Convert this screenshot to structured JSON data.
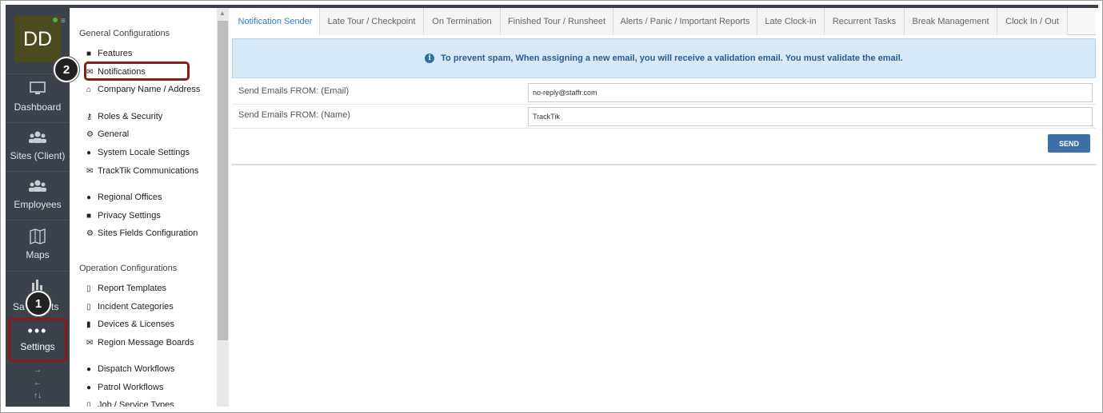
{
  "rail": {
    "avatar": "DD",
    "items": [
      {
        "label": "Dashboard",
        "icon": "monitor-icon"
      },
      {
        "label": "Sites (Client)",
        "icon": "users-icon"
      },
      {
        "label": "Employees",
        "icon": "users-icon"
      },
      {
        "label": "Maps",
        "icon": "map-icon"
      },
      {
        "label": "Sa",
        "icon": "bar-chart-icon"
      }
    ],
    "reports_suffix": "ts",
    "settings": {
      "label": "Settings",
      "dots": "•••"
    },
    "arrows": [
      "→",
      "←",
      "↑↓"
    ]
  },
  "callouts": {
    "one": "1",
    "two": "2"
  },
  "menu": {
    "general_header": "General Configurations",
    "general_items": [
      {
        "label": "Features",
        "icon": "briefcase-icon"
      },
      {
        "label": "Notifications",
        "icon": "envelope-icon"
      },
      {
        "label": "Company Name / Address",
        "icon": "home-icon"
      },
      {
        "label": "Roles & Security",
        "icon": "key-icon"
      },
      {
        "label": "General",
        "icon": "gear-icon"
      },
      {
        "label": "System Locale Settings",
        "icon": "globe-icon"
      },
      {
        "label": "TrackTik Communications",
        "icon": "envelope-icon"
      },
      {
        "label": "Regional Offices",
        "icon": "globe-icon"
      },
      {
        "label": "Privacy Settings",
        "icon": "lock-icon"
      },
      {
        "label": "Sites Fields Configuration",
        "icon": "gear-icon"
      }
    ],
    "operation_header": "Operation Configurations",
    "operation_items": [
      {
        "label": "Report Templates",
        "icon": "file-icon"
      },
      {
        "label": "Incident Categories",
        "icon": "file-icon"
      },
      {
        "label": "Devices & Licenses",
        "icon": "tablet-icon"
      },
      {
        "label": "Region Message Boards",
        "icon": "envelope-icon"
      },
      {
        "label": "Dispatch Workflows",
        "icon": "globe-icon"
      },
      {
        "label": "Patrol Workflows",
        "icon": "globe-icon"
      },
      {
        "label": "Job / Service Types",
        "icon": "file-icon"
      }
    ]
  },
  "tabs": [
    "Notification Sender",
    "Late Tour / Checkpoint",
    "On Termination",
    "Finished Tour / Runsheet",
    "Alerts / Panic / Important Reports",
    "Late Clock-in",
    "Recurrent Tasks",
    "Break Management",
    "Clock In / Out"
  ],
  "active_tab": "Notification Sender",
  "alert": {
    "icon": "i",
    "text": "To prevent spam, When assigning a new email, you will receive a validation email. You must validate the email."
  },
  "form": {
    "email_label": "Send Emails FROM: (Email)",
    "email_value": "no-reply@staffr.com",
    "name_label": "Send Emails FROM: (Name)",
    "name_value": "TrackTik",
    "send_label": "SEND"
  },
  "colors": {
    "rail": "#3b424b",
    "highlight": "#8b1a1a",
    "accent": "#3f6fa6",
    "alert_bg": "#d7e9f6"
  }
}
